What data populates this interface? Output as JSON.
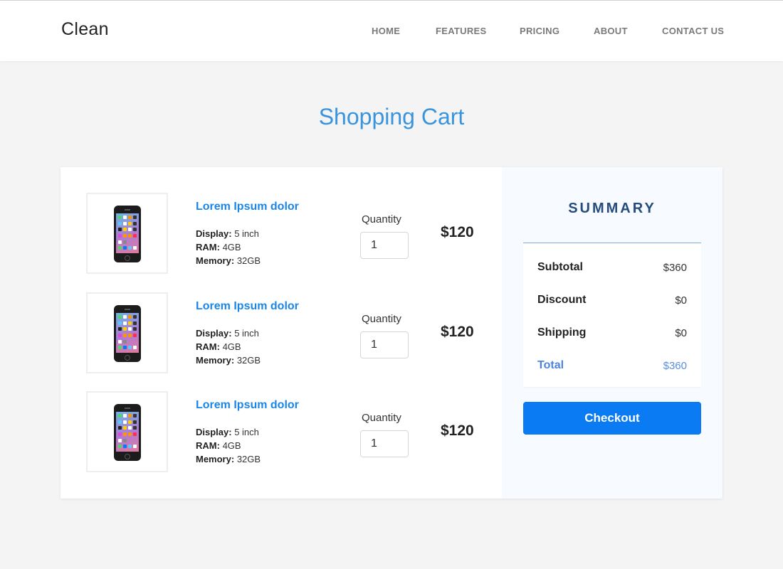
{
  "header": {
    "brand": "Clean",
    "nav": [
      {
        "label": "HOME"
      },
      {
        "label": "FEATURES"
      },
      {
        "label": "PRICING"
      },
      {
        "label": "ABOUT"
      },
      {
        "label": "CONTACT US"
      }
    ]
  },
  "page": {
    "title": "Shopping Cart"
  },
  "cart": {
    "quantity_label": "Quantity",
    "items": [
      {
        "name": "Lorem Ipsum dolor",
        "image": "iphone-icon",
        "specs": [
          {
            "label": "Display:",
            "value": "5 inch"
          },
          {
            "label": "RAM:",
            "value": "4GB"
          },
          {
            "label": "Memory:",
            "value": "32GB"
          }
        ],
        "quantity": "1",
        "price": "$120"
      },
      {
        "name": "Lorem Ipsum dolor",
        "image": "iphone-icon",
        "specs": [
          {
            "label": "Display:",
            "value": "5 inch"
          },
          {
            "label": "RAM:",
            "value": "4GB"
          },
          {
            "label": "Memory:",
            "value": "32GB"
          }
        ],
        "quantity": "1",
        "price": "$120"
      },
      {
        "name": "Lorem Ipsum dolor",
        "image": "iphone-icon",
        "specs": [
          {
            "label": "Display:",
            "value": "5 inch"
          },
          {
            "label": "RAM:",
            "value": "4GB"
          },
          {
            "label": "Memory:",
            "value": "32GB"
          }
        ],
        "quantity": "1",
        "price": "$120"
      }
    ]
  },
  "summary": {
    "title": "SUMMARY",
    "rows": [
      {
        "label": "Subtotal",
        "value": "$360"
      },
      {
        "label": "Discount",
        "value": "$0"
      },
      {
        "label": "Shipping",
        "value": "$0"
      },
      {
        "label": "Total",
        "value": "$360"
      }
    ],
    "checkout_label": "Checkout"
  },
  "colors": {
    "accent": "#1a86e8",
    "title": "#3a94dd",
    "summary_title": "#244c7c",
    "total": "#4b84e0",
    "checkout": "#0a7bf3",
    "background": "#f4f4f4"
  }
}
